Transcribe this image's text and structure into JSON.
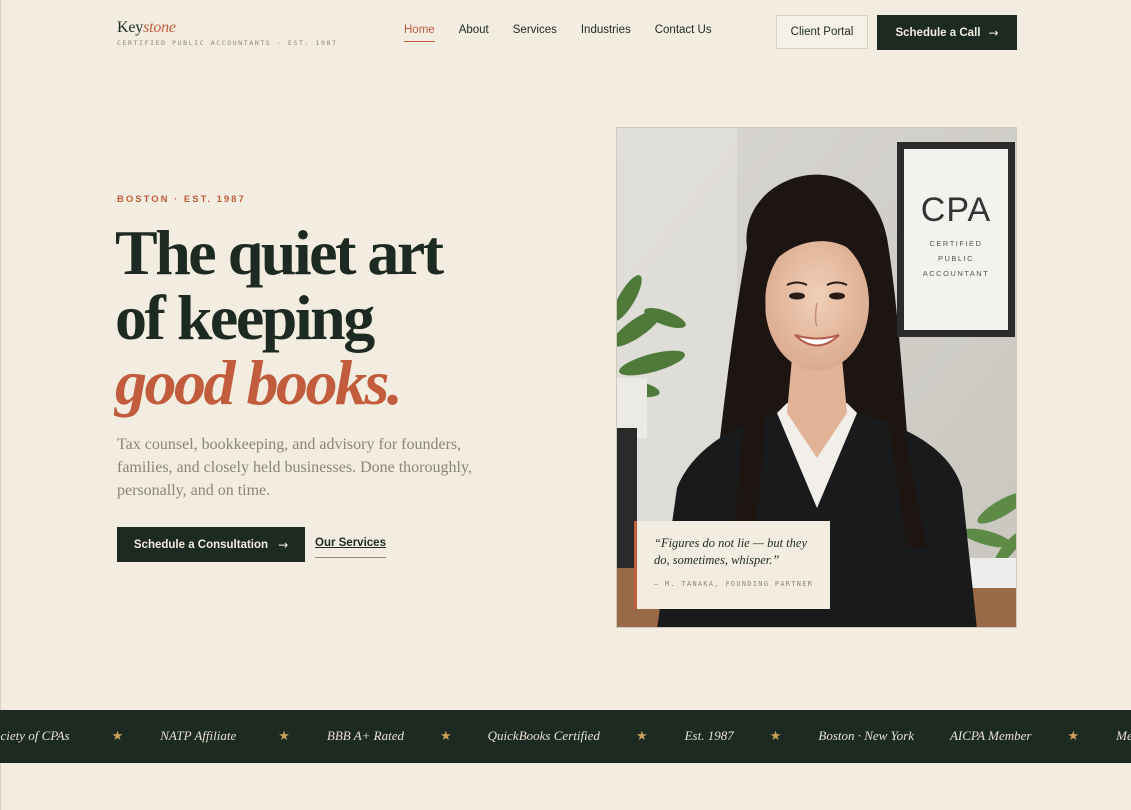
{
  "brand": {
    "name_plain": "Key",
    "name_accent": "stone",
    "tagline": "CERTIFIED PUBLIC ACCOUNTANTS · EST. 1987"
  },
  "nav": {
    "items": [
      {
        "label": "Home",
        "active": true
      },
      {
        "label": "About"
      },
      {
        "label": "Services"
      },
      {
        "label": "Industries"
      },
      {
        "label": "Contact Us"
      }
    ],
    "client_portal": "Client Portal",
    "schedule_call": "Schedule a Call",
    "arrow_icon": "→"
  },
  "hero": {
    "eyebrow": "BOSTON · EST. 1987",
    "headline_line1": "The quiet art",
    "headline_line2": "of keeping",
    "headline_italic": "good books.",
    "lede": "Tax counsel, bookkeeping, and advisory for founders, families, and closely held businesses. Done thoroughly, personally, and on time.",
    "cta_primary": "Schedule a Consultation",
    "cta_secondary": "Our Services"
  },
  "photo": {
    "sign_title": "CPA",
    "sign_line1": "CERTIFIED",
    "sign_line2": "PUBLIC",
    "sign_line3": "ACCOUNTANT"
  },
  "quote": {
    "text": "“Figures do not lie — but they do, sometimes, whisper.”",
    "attribution": "— M. TANAKA, FOUNDING PARTNER"
  },
  "marquee": {
    "items": [
      "ociety of CPAs",
      "NATP Affiliate",
      "BBB A+ Rated",
      "QuickBooks Certified",
      "Est. 1987",
      "Boston · New York",
      "AICPA Member",
      "Me"
    ],
    "star": "★"
  },
  "colors": {
    "background": "#f3ede1",
    "ink": "#1c2a22",
    "accent": "#c15c3d",
    "muted": "#8a8578",
    "gold": "#c9a15a"
  }
}
